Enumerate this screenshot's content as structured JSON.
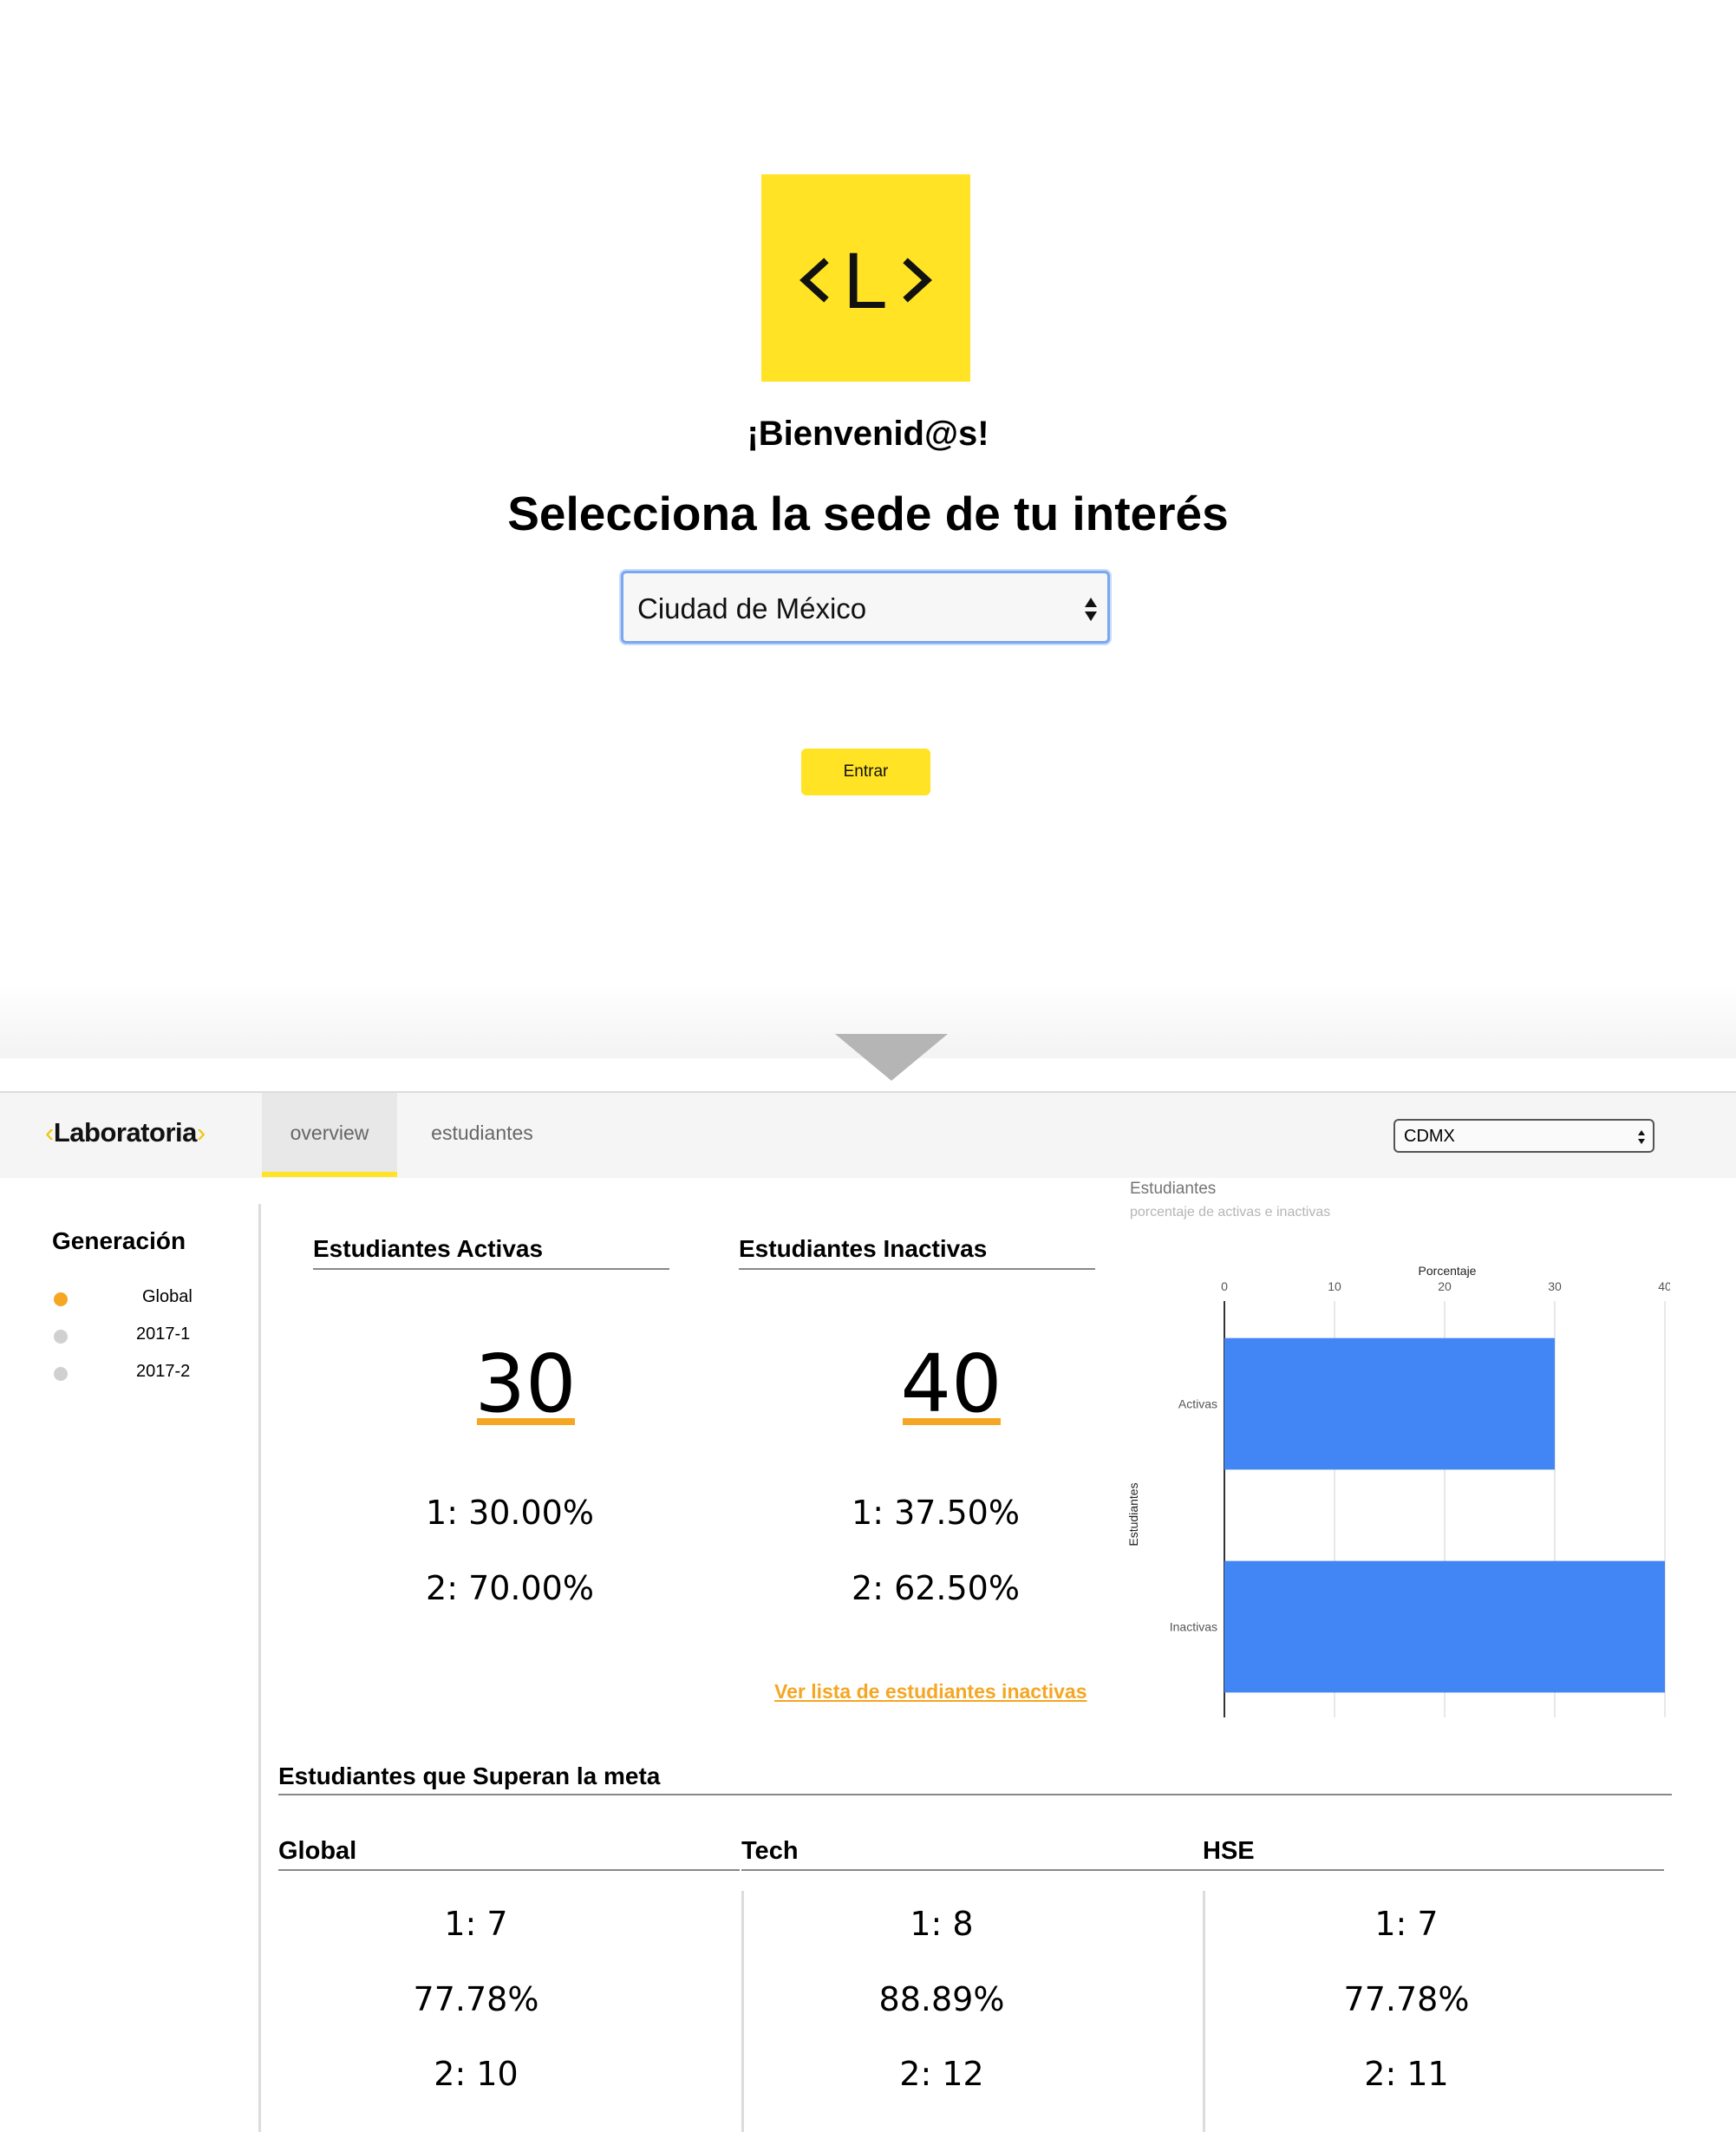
{
  "login": {
    "logo_letter": "L",
    "welcome": "¡Bienvenid@s!",
    "heading": "Selecciona la sede de tu interés",
    "sede_selected": "Ciudad de México",
    "enter_label": "Entrar"
  },
  "dashboard": {
    "brand": {
      "left": "‹",
      "name": "Laboratoria",
      "right": "›"
    },
    "tabs": [
      "overview",
      "estudiantes"
    ],
    "active_tab": "overview",
    "sede_selected": "CDMX",
    "sidebar": {
      "title": "Generación",
      "options": [
        {
          "label": "Global",
          "selected": true
        },
        {
          "label": "2017-1",
          "selected": false
        },
        {
          "label": "2017-2",
          "selected": false
        }
      ]
    },
    "activas": {
      "title": "Estudiantes Activas",
      "total": "30",
      "line1": "1: 30.00%",
      "line2": "2: 70.00%"
    },
    "inactivas": {
      "title": "Estudiantes Inactivas",
      "total": "40",
      "line1": "1: 37.50%",
      "line2": "2: 62.50%",
      "link": "Ver lista de estudiantes inactivas"
    },
    "meta": {
      "title": "Estudiantes que Superan la meta",
      "columns": [
        {
          "title": "Global",
          "line1": "1: 7",
          "percent": "77.78%",
          "line2": "2: 10"
        },
        {
          "title": "Tech",
          "line1": "1: 8",
          "percent": "88.89%",
          "line2": "2: 12"
        },
        {
          "title": "HSE",
          "line1": "1: 7",
          "percent": "77.78%",
          "line2": "2: 11"
        }
      ]
    },
    "colors": {
      "accent_yellow": "#ffe324",
      "accent_orange": "#f5a623",
      "bar_blue": "#4285f4"
    }
  },
  "chart_data": {
    "type": "bar",
    "orientation": "horizontal",
    "title": "Estudiantes",
    "subtitle": "porcentaje de activas e inactivas",
    "xlabel": "Porcentaje",
    "ylabel": "Estudiantes",
    "categories": [
      "Activas",
      "Inactivas"
    ],
    "values": [
      30,
      40
    ],
    "xlim": [
      0,
      40
    ],
    "xticks": [
      "0",
      "10",
      "20",
      "30",
      "40"
    ],
    "grid": true,
    "legend": "none"
  }
}
